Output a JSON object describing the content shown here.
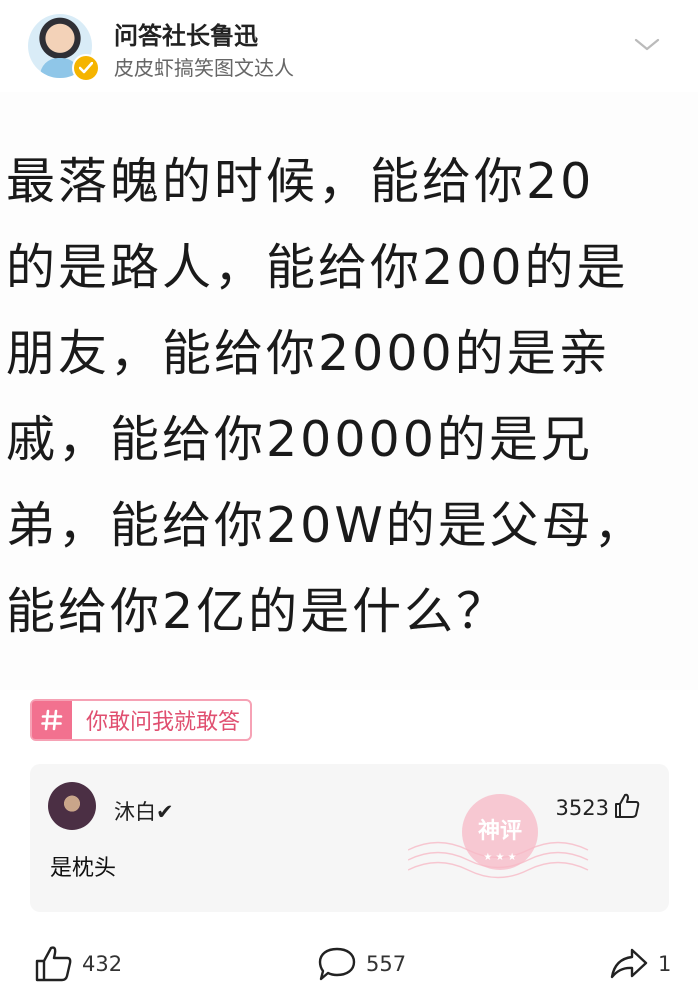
{
  "post": {
    "author": "问答社长鲁迅",
    "author_subtitle": "皮皮虾搞笑图文达人",
    "image_text_lines": [
      "最落魄的时候，能给你20",
      "的是路人，能给你200的是",
      "朋友，能给你2000的是亲",
      "戚，能给你20000的是兄",
      "弟，能给你20W的是父母，",
      "能给你2亿的是什么？"
    ],
    "topic_tag": "你敢问我就敢答"
  },
  "god_comment": {
    "username": "沐白✔",
    "likes": "3523",
    "text": "是枕头",
    "stamp_text": "神评"
  },
  "actions": {
    "like_count": "432",
    "comment_count": "557",
    "share_count": "1"
  },
  "colors": {
    "topic_accent": "#f2718f",
    "verified_badge": "#f5b400",
    "stamp": "#f7b8c5"
  }
}
